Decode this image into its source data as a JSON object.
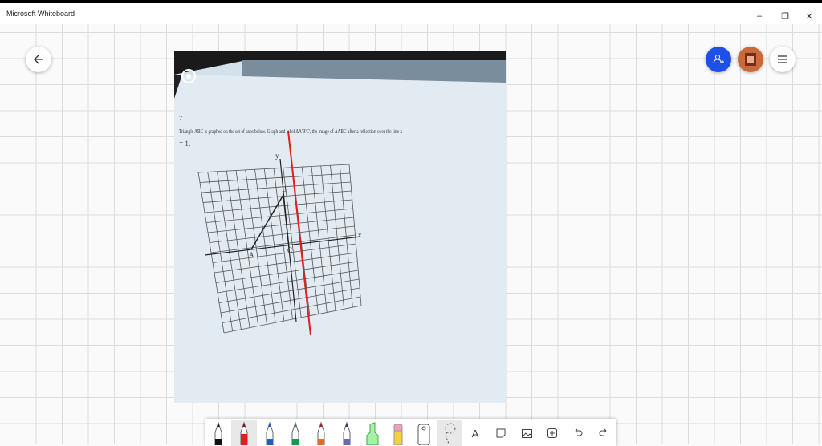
{
  "window": {
    "title": "Microsoft Whiteboard",
    "minimize": "–",
    "restore": "❐",
    "close": "✕"
  },
  "photo": {
    "problem_number": "7.",
    "question_line1": "Triangle ABC is graphed on the set of axes below. Graph and label ΔA'B'C', the image of ΔABC after a reflection over the line x",
    "question_line2": "= 1.",
    "axis_y": "y",
    "axis_x": "x",
    "label_a": "A",
    "label_b": "B",
    "label_c": "C"
  },
  "toolbar": {
    "text_tool": "A"
  },
  "colors": {
    "accent": "#1e4fe6",
    "pen_red": "#e02020"
  }
}
